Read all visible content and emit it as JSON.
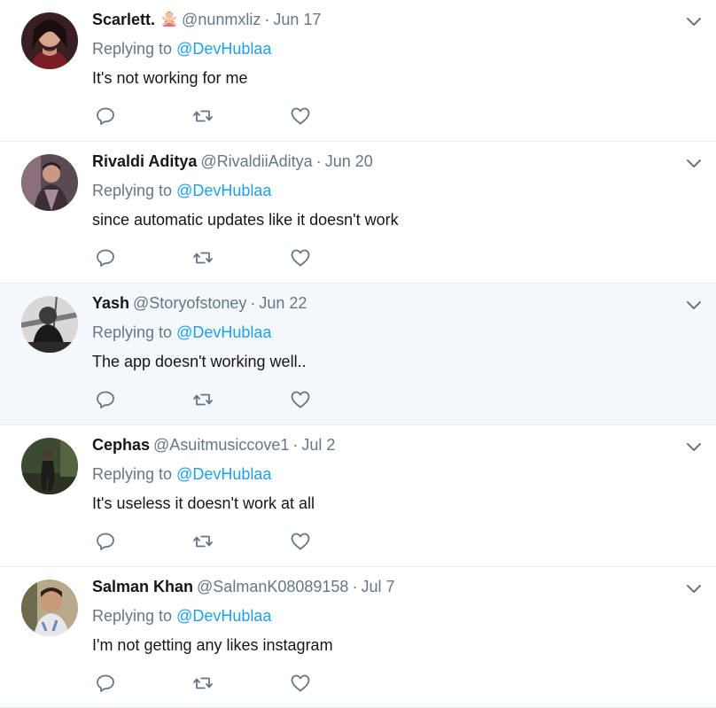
{
  "reply_prefix": "Replying to",
  "tweets": [
    {
      "name": "Scarlett.",
      "emoji": "person-gesturing-no-emoji",
      "handle": "@nunmxliz",
      "sep": "·",
      "date": "Jun 17",
      "mention": "@DevHublaa",
      "text": "It's not working for me"
    },
    {
      "name": "Rivaldi Aditya",
      "handle": "@RivaldiiAditya",
      "sep": "·",
      "date": "Jun 20",
      "mention": "@DevHublaa",
      "text": "since automatic updates like it doesn't work"
    },
    {
      "name": "Yash",
      "handle": "@Storyofstoney",
      "sep": "·",
      "date": "Jun 22",
      "mention": "@DevHublaa",
      "text": "The app doesn't working well.."
    },
    {
      "name": "Cephas",
      "handle": "@Asuitmusiccove1",
      "sep": "·",
      "date": "Jul 2",
      "mention": "@DevHublaa",
      "text": "It's useless it doesn't work at all"
    },
    {
      "name": "Salman Khan",
      "handle": "@SalmanK08089158",
      "sep": "·",
      "date": "Jul 7",
      "mention": "@DevHublaa",
      "text": "I'm not getting any likes instagram"
    }
  ],
  "icons": {
    "reply": "reply-icon",
    "retweet": "retweet-icon",
    "like": "heart-icon",
    "more": "chevron-down-icon"
  },
  "colors": {
    "link": "#1da1f2",
    "secondary_text": "#657786",
    "primary_text": "#14171a",
    "hover_bg": "#f5f8fa",
    "divider": "#e6ecf0"
  }
}
